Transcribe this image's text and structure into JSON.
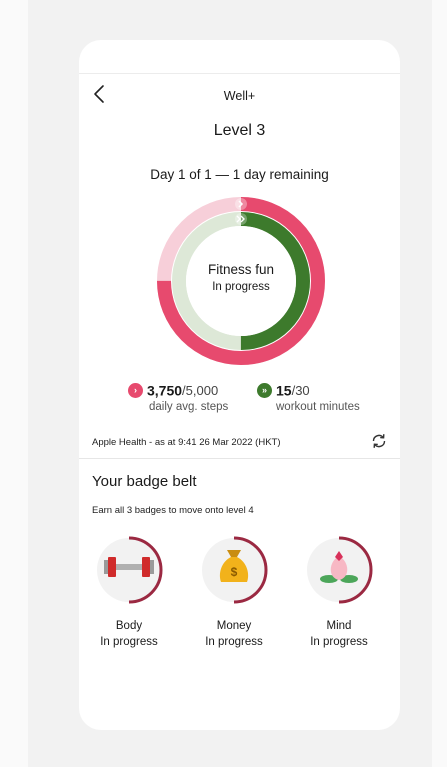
{
  "header": {
    "title": "Well+",
    "level_title": "Level 3"
  },
  "progress": {
    "day_text": "Day 1 of 1 — 1 day remaining",
    "ring_title": "Fitness fun",
    "ring_status": "In progress",
    "steps": {
      "value": "3,750",
      "target": "/5,000",
      "label": "daily avg. steps",
      "fraction": 0.75,
      "color": "#e74a6e"
    },
    "workout": {
      "value": "15",
      "target": "/30",
      "label": "workout minutes",
      "fraction": 0.5,
      "color": "#3d7a2c"
    }
  },
  "source": {
    "text": "Apple Health - as at 9:41 26 Mar 2022 (HKT)"
  },
  "badge_belt": {
    "title": "Your badge belt",
    "subtitle": "Earn all 3 badges to move onto level 4",
    "badges": [
      {
        "name": "Body",
        "status": "In progress",
        "icon": "dumbbell-icon"
      },
      {
        "name": "Money",
        "status": "In progress",
        "icon": "money-bag-icon"
      },
      {
        "name": "Mind",
        "status": "In progress",
        "icon": "lotus-icon"
      }
    ]
  },
  "colors": {
    "accent_pink": "#e74a6e",
    "accent_green": "#3d7a2c",
    "badge_ring": "#9b2942"
  }
}
